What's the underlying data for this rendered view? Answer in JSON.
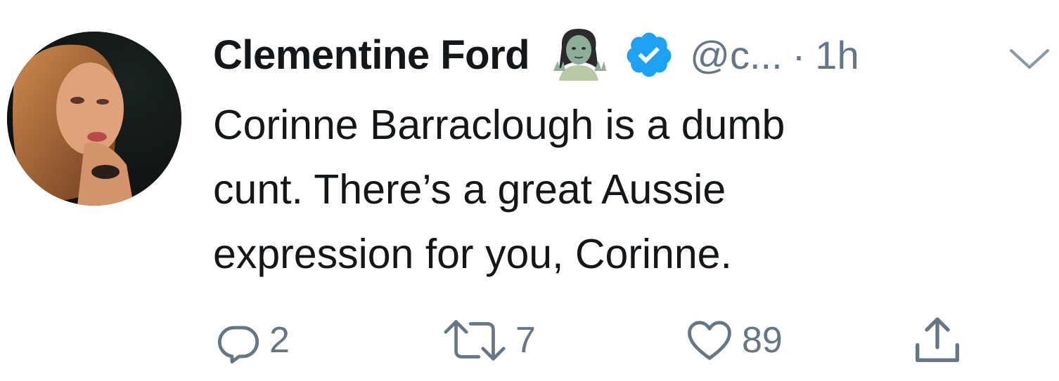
{
  "tweet": {
    "author_name": "Clementine Ford",
    "handle": "@c...",
    "separator": "·",
    "time": "1h",
    "text": "Corinne Barraclough is a dumb\ncunt. There’s a great Aussie\nexpression for you, Corinne.",
    "icons": {
      "name_emoji": "zombie-woman-emoji",
      "verified": "verified-badge-icon",
      "menu": "chevron-down-icon"
    },
    "colors": {
      "text": "#14171a",
      "muted": "#657786",
      "verified": "#1da1f2"
    }
  },
  "actions": {
    "reply_count": "2",
    "retweet_count": "7",
    "like_count": "89"
  }
}
